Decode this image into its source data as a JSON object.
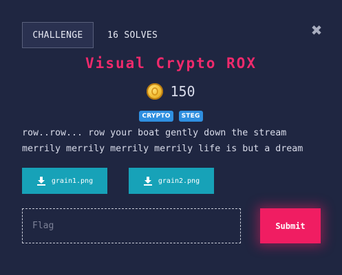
{
  "tabs": {
    "challenge_label": "CHALLENGE",
    "solves_label": "16 SOLVES"
  },
  "close": {
    "glyph": "✖",
    "icon": "close-icon"
  },
  "challenge": {
    "title": "Visual Crypto ROX",
    "points": "150",
    "tags": [
      "CRYPTO",
      "STEG"
    ],
    "description": [
      "row..row... row your boat gently down the stream",
      "merrily merrily merrily merrily life is but a dream"
    ]
  },
  "files": [
    {
      "name": "grain1.png",
      "icon": "download-icon"
    },
    {
      "name": "grain2.png",
      "icon": "download-icon"
    }
  ],
  "flag": {
    "placeholder": "Flag",
    "value": ""
  },
  "submit_label": "Submit",
  "colors": {
    "background": "#1f2641",
    "title": "#ef2a6c",
    "tag": "#2f8fe0",
    "file_button": "#17a2b8",
    "submit": "#f01d62",
    "coin": "#f5c23a"
  }
}
